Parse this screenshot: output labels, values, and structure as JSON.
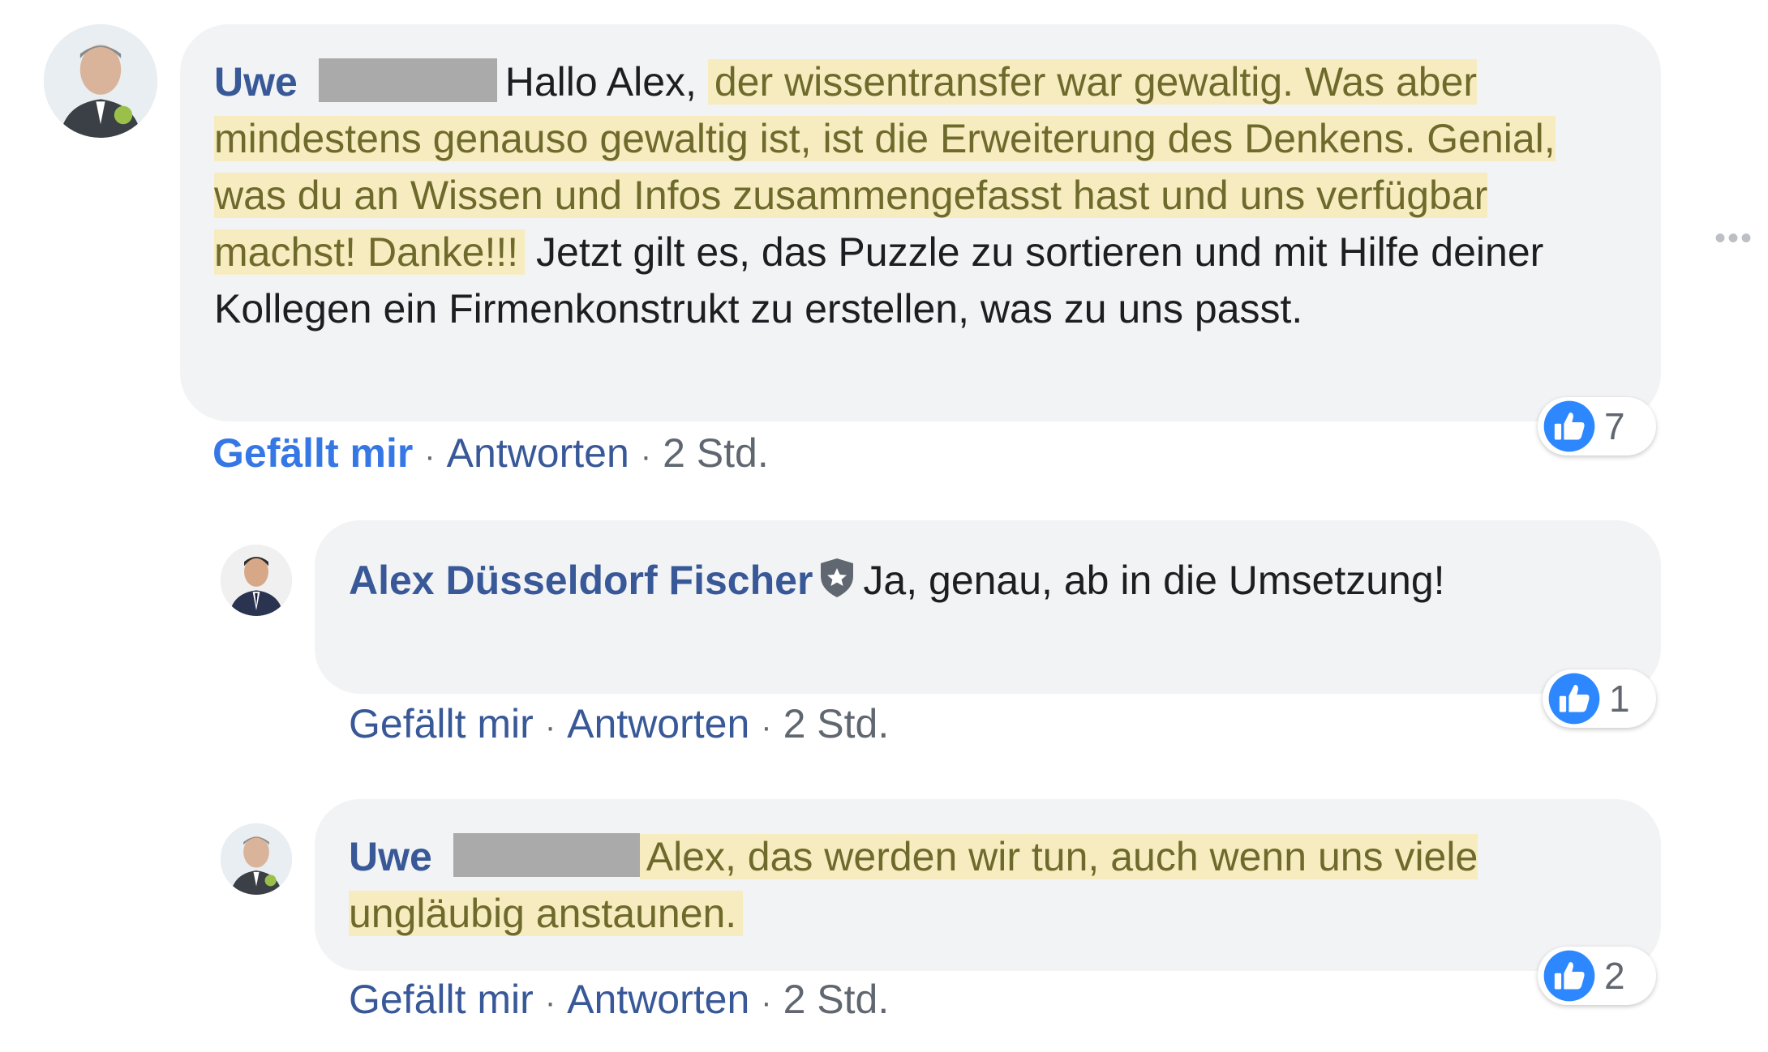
{
  "colors": {
    "author": "#385898",
    "like_active": "#3578e5",
    "bubble": "#f2f3f5",
    "highlight": "#f7ecbf",
    "highlight_text": "#6e6a2c"
  },
  "comments": [
    {
      "author": "Uwe",
      "text_plain_before": "Hallo Alex, ",
      "text_highlight": "der wissentransfer war gewaltig. Was aber mindestens genauso gewaltig ist, ist die Erweiterung des Denkens. Genial, was du an Wissen und Infos zusammengefasst hast und uns verfügbar machst! Danke!!!",
      "text_plain_after": " Jetzt gilt es, das Puzzle zu sortieren und mit Hilfe deiner Kollegen ein Firmenkonstrukt zu erstellen, was zu uns passt.",
      "actions": {
        "like": "Gefällt mir",
        "reply": "Antworten",
        "time": "2 Std."
      },
      "reaction_icon": "thumbs-up-icon",
      "reaction_count": "7"
    },
    {
      "author": "Alex Düsseldorf Fischer",
      "badge_icon": "shield-star-icon",
      "text": "Ja, genau, ab in die Umsetzung!",
      "actions": {
        "like": "Gefällt mir",
        "reply": "Antworten",
        "time": "2 Std."
      },
      "reaction_icon": "thumbs-up-icon",
      "reaction_count": "1"
    },
    {
      "author": "Uwe",
      "text_highlight": "Alex, das werden wir tun, auch wenn uns viele ungläubig anstaunen.",
      "actions": {
        "like": "Gefällt mir",
        "reply": "Antworten",
        "time": "2 Std."
      },
      "reaction_icon": "thumbs-up-icon",
      "reaction_count": "2"
    }
  ],
  "more_icon": "more-options-icon"
}
